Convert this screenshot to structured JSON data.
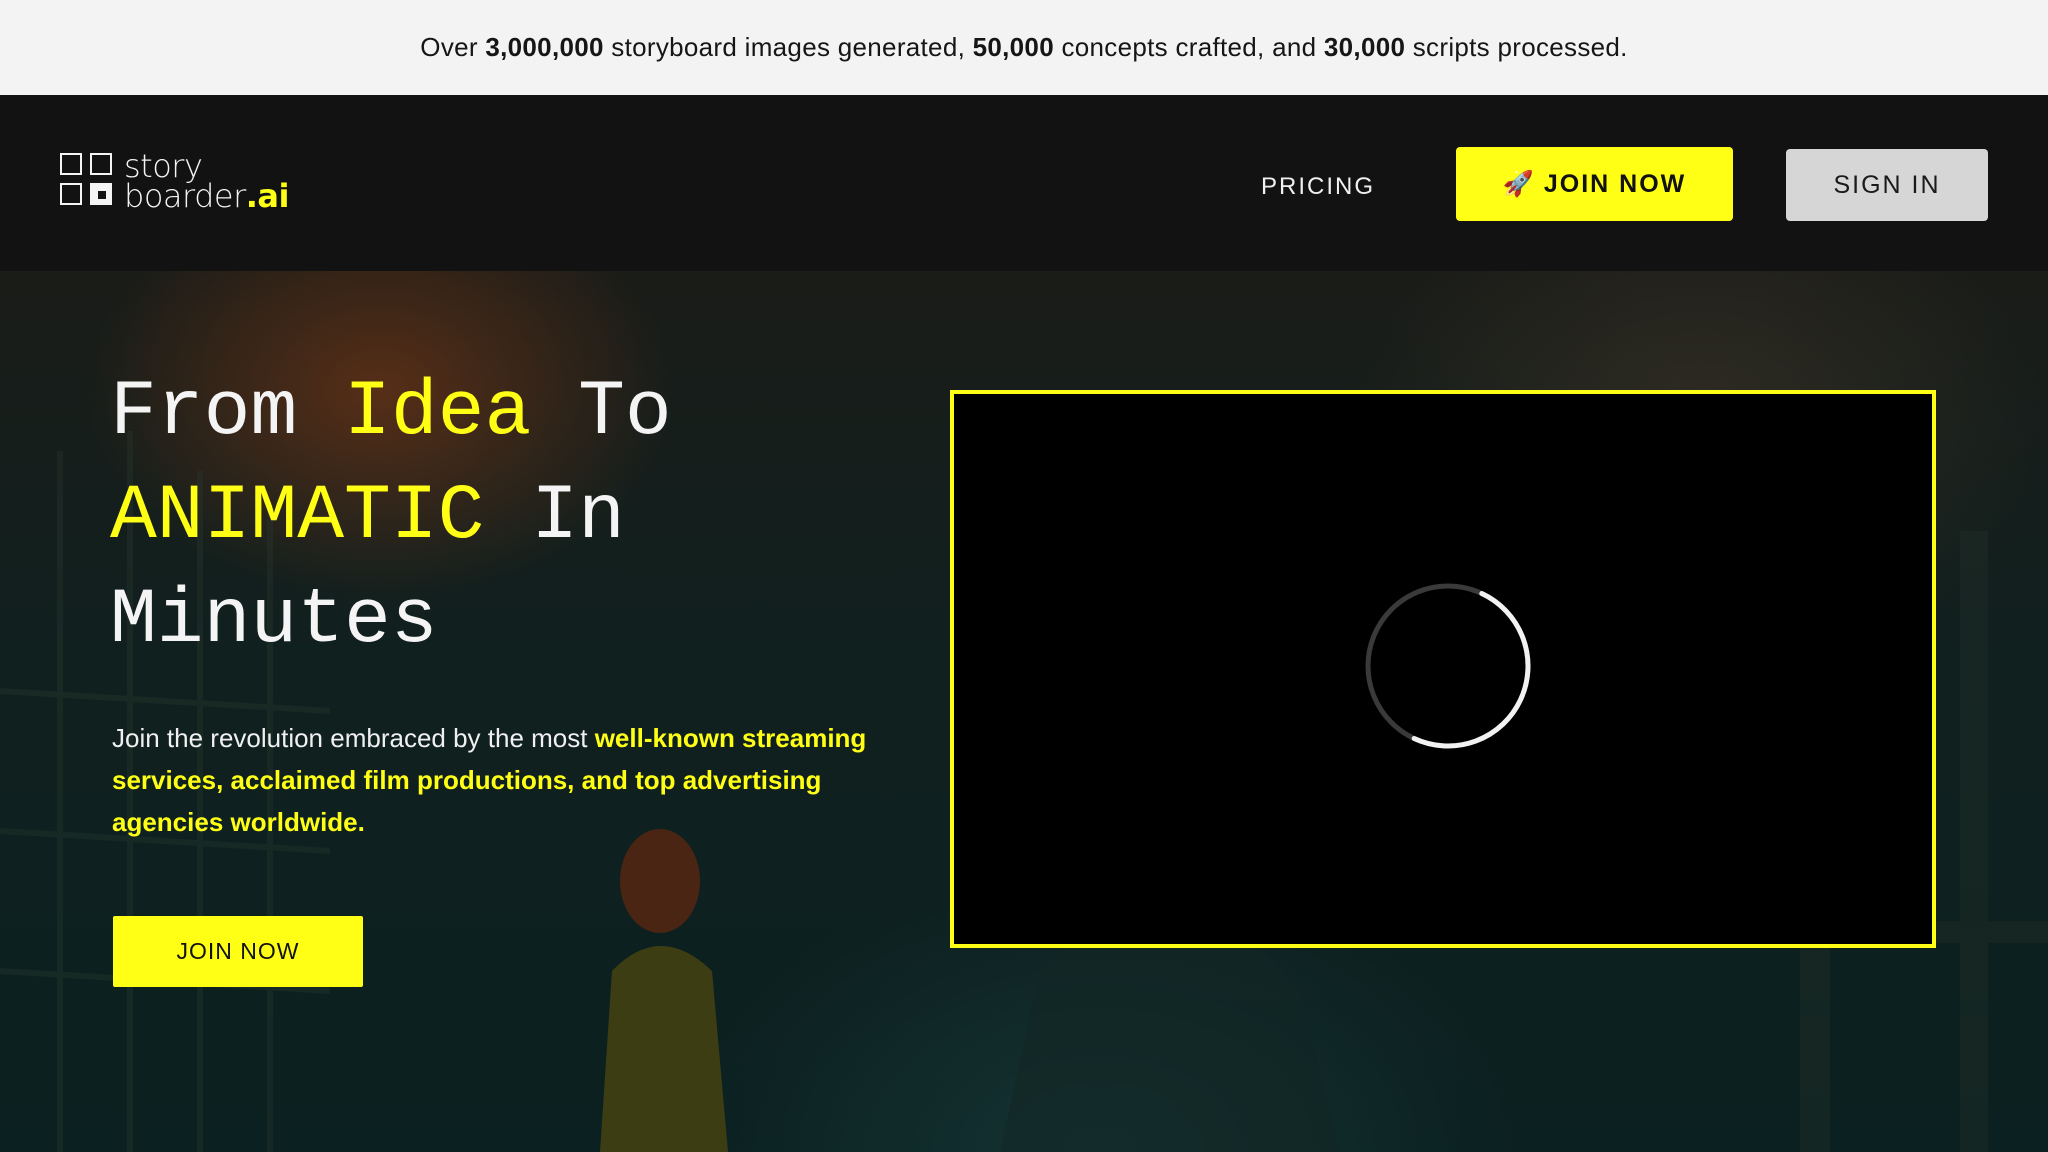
{
  "promo": {
    "t1": "Over ",
    "n1": "3,000,000",
    "t2": " storyboard images generated, ",
    "n2": "50,000",
    "t3": " concepts crafted, and ",
    "n3": "30,000",
    "t4": " scripts processed."
  },
  "logo": {
    "top": "story",
    "bottom": "boarder",
    "suffix": ".ai"
  },
  "nav": {
    "pricing": "PRICING",
    "join_icon": "🚀",
    "join_label": "JOIN NOW",
    "signin_label": "SIGN IN"
  },
  "hero": {
    "title": {
      "w1": "From ",
      "w2": "Idea",
      "w3": " To",
      "w4": "ANIMATIC",
      "w5": " In",
      "w6": "Minutes"
    },
    "desc_plain": "Join the revolution embraced by the most ",
    "desc_highlight": "well-known streaming services, acclaimed film productions, and top advertising agencies worldwide.",
    "join_label": "JOIN NOW"
  },
  "colors": {
    "accent": "#ffff16",
    "nav_bg": "#121212",
    "promo_bg": "#f3f3f3",
    "signin_bg": "#d6d6d6"
  },
  "icons": {
    "join": "rocket-icon",
    "loading": "loading-spinner-icon"
  }
}
